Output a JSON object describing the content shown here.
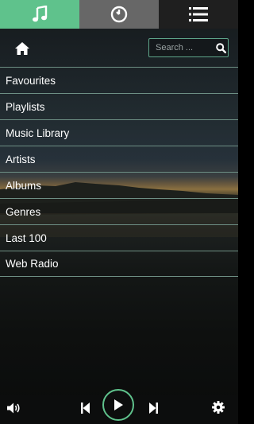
{
  "tabs": [
    {
      "name": "music",
      "icon": "music-note-icon",
      "color": "#5fc28c",
      "active": true
    },
    {
      "name": "clock",
      "icon": "clock-icon",
      "color": "#676767",
      "active": false
    },
    {
      "name": "list",
      "icon": "list-icon",
      "color": "#1f1f1f",
      "active": false
    }
  ],
  "search": {
    "placeholder": "Search ...",
    "value": ""
  },
  "menu": {
    "items": [
      {
        "label": "Favourites"
      },
      {
        "label": "Playlists"
      },
      {
        "label": "Music Library"
      },
      {
        "label": "Artists"
      },
      {
        "label": "Albums"
      },
      {
        "label": "Genres"
      },
      {
        "label": "Last 100"
      },
      {
        "label": "Web Radio"
      }
    ]
  },
  "player": {
    "controls": [
      "volume-icon",
      "previous-icon",
      "play-icon",
      "next-icon",
      "gear-icon"
    ],
    "accent": "#5fc28c"
  }
}
